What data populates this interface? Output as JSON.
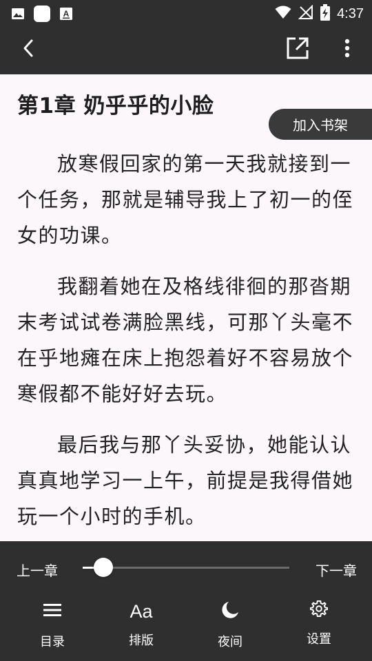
{
  "status_bar": {
    "time": "4:37",
    "left_icons": [
      "image-icon",
      "app-icon",
      "font-download-icon"
    ],
    "right_icons": [
      "wifi-icon",
      "no-signal-icon",
      "battery-charging-icon"
    ]
  },
  "app_bar": {
    "back_icon": "chevron-left-icon",
    "share_icon": "open-external-icon",
    "more_icon": "more-vertical-icon"
  },
  "chapter": {
    "title": "第1章 奶乎乎的小脸",
    "paragraphs": [
      "放寒假回家的第一天我就接到一个任务，那就是辅导我上了初一的侄女的功课。",
      "我翻着她在及格线徘徊的那沓期末考试试卷满脸黑线，可那丫头毫不在乎地瘫在床上抱怨着好不容易放个寒假都不能好好去玩。",
      "最后我与那丫头妥协，她能认认真真地学习一上午，前提是我得借她玩一个小时的手机。"
    ]
  },
  "add_to_shelf": "加入书架",
  "chapter_nav": {
    "prev": "上一章",
    "next": "下一章",
    "progress": 0.1
  },
  "bottom_menu": [
    {
      "label": "目录",
      "icon": "menu-list-icon"
    },
    {
      "label": "排版",
      "icon": "font-aa-icon"
    },
    {
      "label": "夜间",
      "icon": "moon-icon"
    },
    {
      "label": "设置",
      "icon": "gear-icon"
    }
  ],
  "colors": {
    "bar_bg": "#2f2f2f",
    "page_bg": "#fbf7fb",
    "text": "#222222"
  }
}
